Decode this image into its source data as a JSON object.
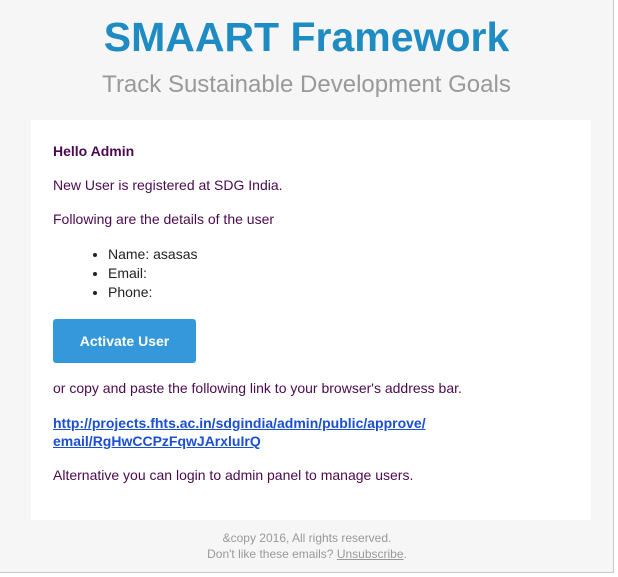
{
  "header": {
    "title": "SMAART Framework",
    "subtitle": "Track Sustainable Development Goals"
  },
  "body": {
    "greeting": "Hello Admin",
    "registered_text": "New User is registered at SDG India.",
    "details_intro": "Following are the details of the user",
    "details": [
      "Name: asasas",
      "Email:",
      "Phone:"
    ],
    "activate_button": "Activate User",
    "copy_text": "or copy and paste the following link to your browser's address bar.",
    "approve_link_line1": "http://projects.fhts.ac.in/sdgindia/admin/public/approve/",
    "approve_link_line2": "email/RgHwCCPzFqwJArxluIrQ",
    "alternative_text": "Alternative you can login to admin panel to manage users."
  },
  "footer": {
    "copyright": "&copy 2016, All rights reserved.",
    "unsubscribe_prefix": "Don't like these emails? ",
    "unsubscribe_link": "Unsubscribe",
    "unsubscribe_suffix": "."
  },
  "colors": {
    "brand_blue": "#1e8bc3",
    "button_blue": "#3498db",
    "text_purple": "#4b0a4f",
    "link_blue": "#1a4fd0"
  }
}
